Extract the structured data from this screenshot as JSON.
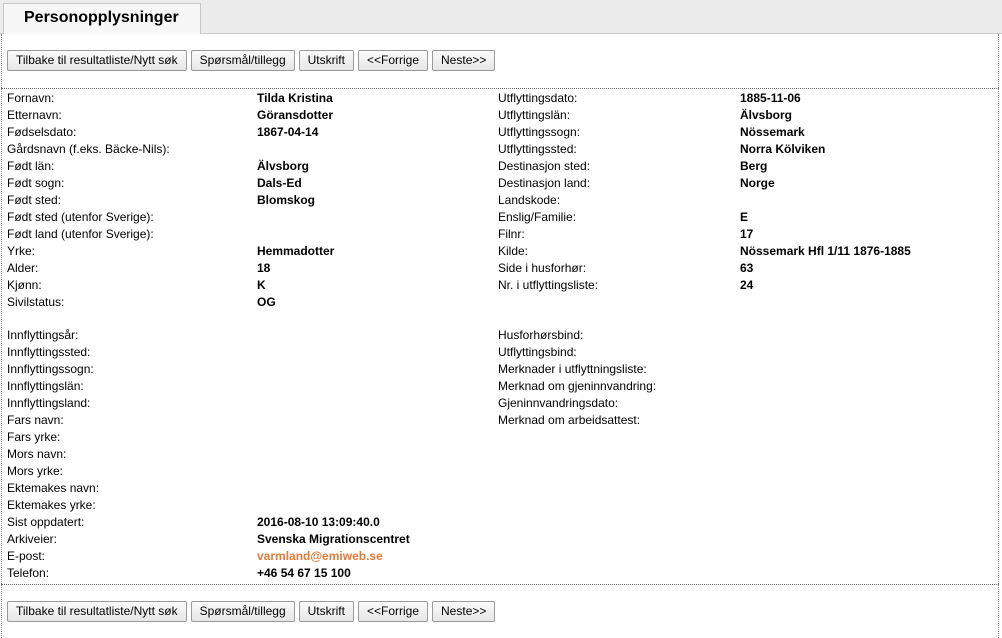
{
  "tab": {
    "title": "Personopplysninger"
  },
  "buttons": {
    "back": "Tilbake til resultatliste/Nytt søk",
    "question": "Spørsmål/tillegg",
    "print": "Utskrift",
    "prev": "<<Forrige",
    "next": "Neste>>"
  },
  "left_fields": [
    {
      "label": "Fornavn:",
      "value": "Tilda Kristina"
    },
    {
      "label": "Etternavn:",
      "value": "Göransdotter"
    },
    {
      "label": "Fødselsdato:",
      "value": "1867-04-14"
    },
    {
      "label": "Gårdsnavn (f.eks. Bäcke-Nils):",
      "value": ""
    },
    {
      "label": "Født län:",
      "value": "Älvsborg"
    },
    {
      "label": "Født sogn:",
      "value": "Dals-Ed"
    },
    {
      "label": "Født sted:",
      "value": "Blomskog"
    },
    {
      "label": "Født sted (utenfor Sverige):",
      "value": ""
    },
    {
      "label": "Født land (utenfor Sverige):",
      "value": ""
    },
    {
      "label": "Yrke:",
      "value": "Hemmadotter"
    },
    {
      "label": "Alder:",
      "value": "18"
    },
    {
      "label": "Kjønn:",
      "value": "K"
    },
    {
      "label": "Sivilstatus:",
      "value": "OG"
    }
  ],
  "left_fields_2": [
    {
      "label": "Innflyttingsår:",
      "value": ""
    },
    {
      "label": "Innflyttingssted:",
      "value": ""
    },
    {
      "label": "Innflyttingssogn:",
      "value": ""
    },
    {
      "label": "Innflyttingslän:",
      "value": ""
    },
    {
      "label": "Innflyttingsland:",
      "value": ""
    },
    {
      "label": "Fars navn:",
      "value": ""
    },
    {
      "label": "Fars yrke:",
      "value": ""
    },
    {
      "label": "Mors navn:",
      "value": ""
    },
    {
      "label": "Mors yrke:",
      "value": ""
    },
    {
      "label": "Ektemakes navn:",
      "value": ""
    },
    {
      "label": "Ektemakes yrke:",
      "value": ""
    },
    {
      "label": "Sist oppdatert:",
      "value": "2016-08-10 13:09:40.0"
    },
    {
      "label": "Arkiveier:",
      "value": "Svenska Migrationscentret"
    },
    {
      "label": "E-post:",
      "value": "varmland@emiweb.se"
    },
    {
      "label": "Telefon:",
      "value": "+46 54 67 15 100"
    }
  ],
  "right_fields": [
    {
      "label": "Utflyttingsdato:",
      "value": "1885-11-06"
    },
    {
      "label": "Utflyttingslän:",
      "value": "Älvsborg"
    },
    {
      "label": "Utflyttingssogn:",
      "value": "Nössemark"
    },
    {
      "label": "Utflyttingssted:",
      "value": "Norra Kölviken"
    },
    {
      "label": "Destinasjon sted:",
      "value": "Berg"
    },
    {
      "label": "Destinasjon land:",
      "value": "Norge"
    },
    {
      "label": "Landskode:",
      "value": ""
    },
    {
      "label": "Enslig/Familie:",
      "value": "E"
    },
    {
      "label": "Filnr:",
      "value": "17"
    },
    {
      "label": "Kilde:",
      "value": "Nössemark Hfl 1/11 1876-1885"
    },
    {
      "label": "Side i husforhør:",
      "value": "63"
    },
    {
      "label": "Nr. i utflyttingsliste:",
      "value": "24"
    }
  ],
  "right_fields_2": [
    {
      "label": "Husforhørsbind:",
      "value": ""
    },
    {
      "label": "Utflyttingsbind:",
      "value": ""
    },
    {
      "label": "Merknader i utflyttningsliste:",
      "value": ""
    },
    {
      "label": "Merknad om gjeninnvandring:",
      "value": ""
    },
    {
      "label": "Gjeninnvandringsdato:",
      "value": ""
    },
    {
      "label": "Merknad om arbeidsattest:",
      "value": ""
    }
  ],
  "colors": {
    "link": "#e07b39",
    "tabbar": "#ececec"
  }
}
